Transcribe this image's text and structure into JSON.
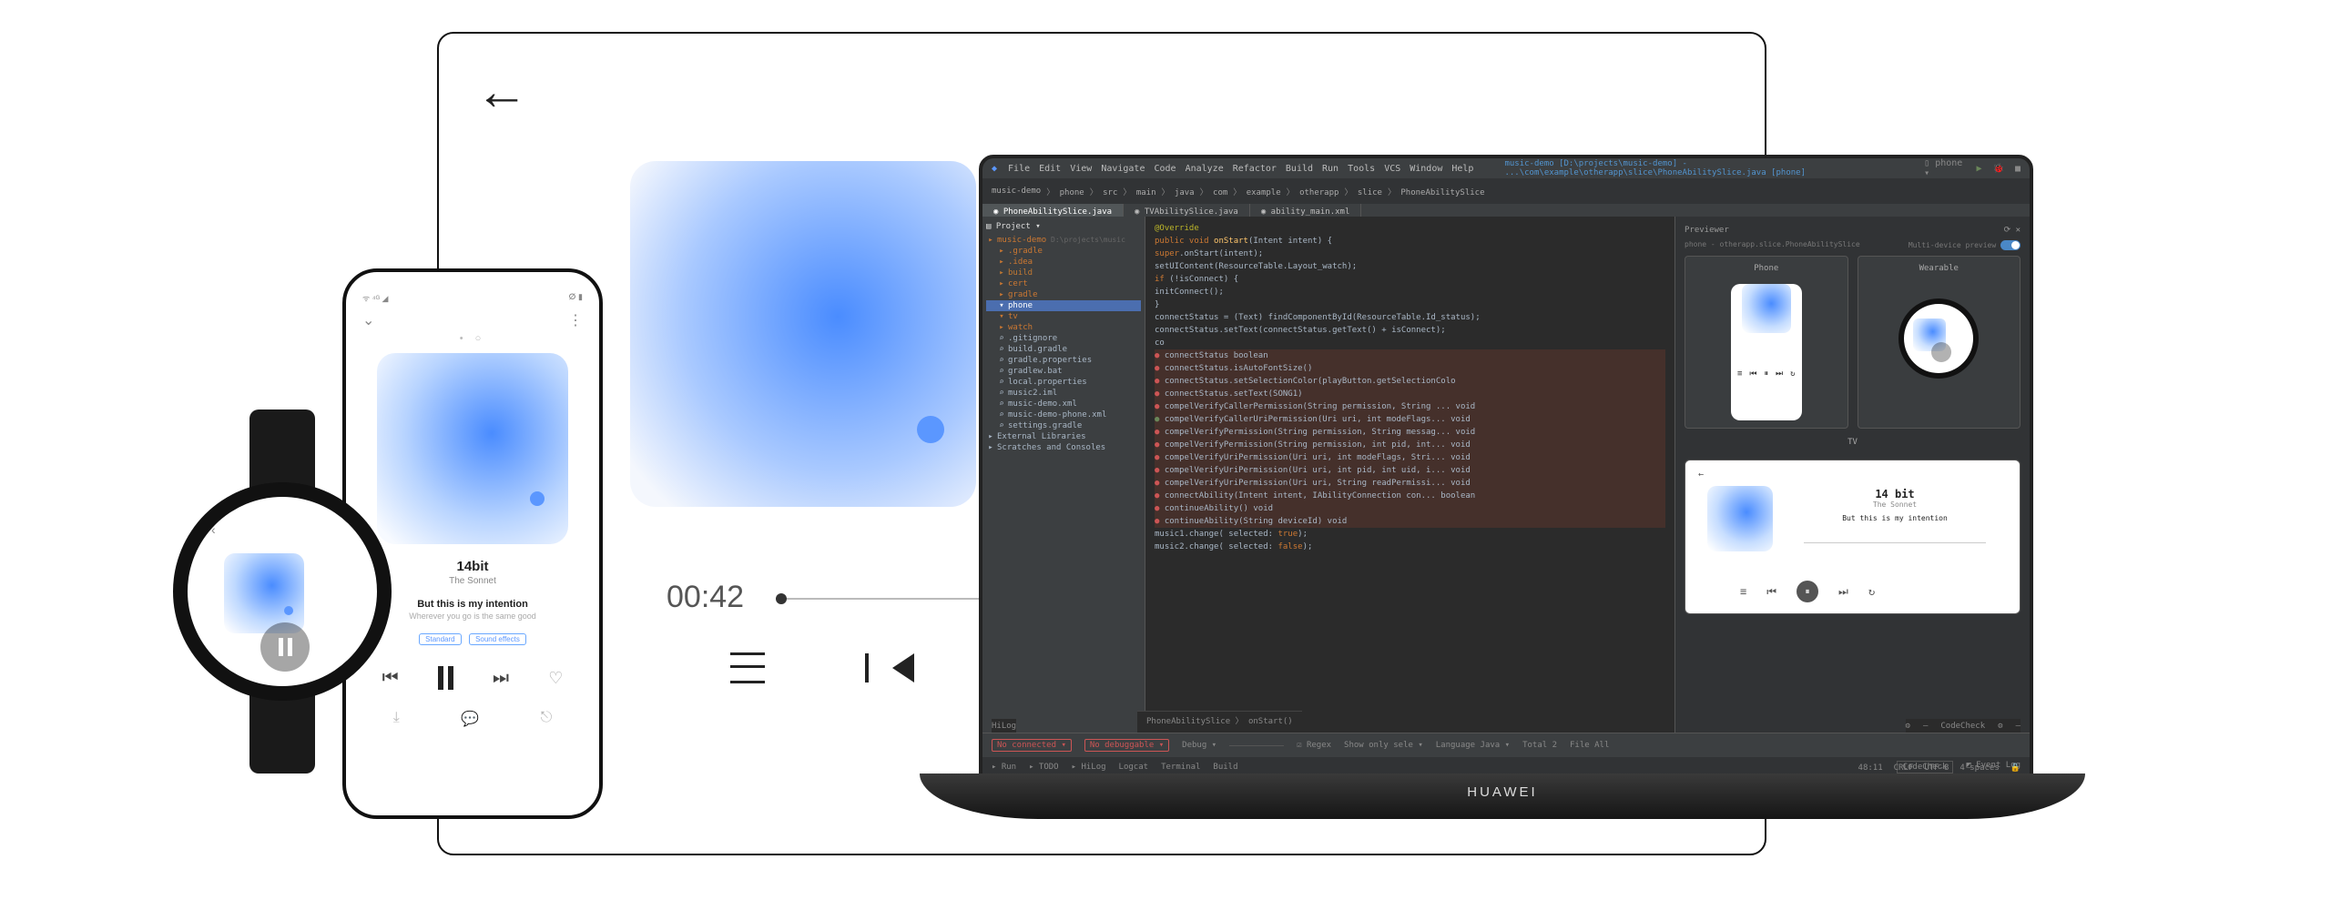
{
  "tv": {
    "time": "00:42"
  },
  "phone": {
    "status_left": "ᯤ ⁴ᴳ ◢",
    "status_right": "ⵁ ▮",
    "title": "14bit",
    "artist": "The Sonnet",
    "lyric1": "But this is my intention",
    "lyric2": "Wherever you go is the same good",
    "badge1": "Standard",
    "badge2": "Sound effects"
  },
  "laptop_brand": "HUAWEI",
  "ide": {
    "menu": [
      "File",
      "Edit",
      "View",
      "Navigate",
      "Code",
      "Analyze",
      "Refactor",
      "Build",
      "Run",
      "Tools",
      "VCS",
      "Window",
      "Help"
    ],
    "project_title": "music-demo [D:\\projects\\music-demo] - ...\\com\\example\\otherapp\\slice\\PhoneAbilitySlice.java [phone]",
    "crumb": [
      "music-demo",
      "phone",
      "src",
      "main",
      "java",
      "com",
      "example",
      "otherapp",
      "slice",
      "PhoneAbilitySlice"
    ],
    "run_target": "phone",
    "tabs": [
      {
        "label": "PhoneAbilitySlice.java",
        "active": true
      },
      {
        "label": "TVAbilitySlice.java",
        "active": false
      },
      {
        "label": "ability_main.xml",
        "active": false
      }
    ],
    "tree_header": "Project",
    "tree": [
      {
        "indent": 0,
        "icon": "▸",
        "label": "music-demo",
        "cls": "folder",
        "suffix": " D:\\projects\\music"
      },
      {
        "indent": 1,
        "icon": "▸",
        "label": ".gradle",
        "cls": "folder"
      },
      {
        "indent": 1,
        "icon": "▸",
        "label": ".idea",
        "cls": "folder"
      },
      {
        "indent": 1,
        "icon": "▸",
        "label": "build",
        "cls": "folder",
        "style": "color:#c07832"
      },
      {
        "indent": 1,
        "icon": "▸",
        "label": "cert",
        "cls": "folder"
      },
      {
        "indent": 1,
        "icon": "▸",
        "label": "gradle",
        "cls": "folder"
      },
      {
        "indent": 1,
        "icon": "▾",
        "label": "phone",
        "cls": "folder selected"
      },
      {
        "indent": 1,
        "icon": "▾",
        "label": "tv",
        "cls": "folder"
      },
      {
        "indent": 1,
        "icon": "▸",
        "label": "watch",
        "cls": "folder"
      },
      {
        "indent": 1,
        "icon": "⌕",
        "label": ".gitignore",
        "cls": "file"
      },
      {
        "indent": 1,
        "icon": "⌕",
        "label": "build.gradle",
        "cls": "file"
      },
      {
        "indent": 1,
        "icon": "⌕",
        "label": "gradle.properties",
        "cls": "file"
      },
      {
        "indent": 1,
        "icon": "⌕",
        "label": "gradlew.bat",
        "cls": "file"
      },
      {
        "indent": 1,
        "icon": "⌕",
        "label": "local.properties",
        "cls": "file"
      },
      {
        "indent": 1,
        "icon": "⌕",
        "label": "music2.iml",
        "cls": "file"
      },
      {
        "indent": 1,
        "icon": "⌕",
        "label": "music-demo.xml",
        "cls": "file"
      },
      {
        "indent": 1,
        "icon": "⌕",
        "label": "music-demo-phone.xml",
        "cls": "file"
      },
      {
        "indent": 1,
        "icon": "⌕",
        "label": "settings.gradle",
        "cls": "file"
      },
      {
        "indent": 0,
        "icon": "▸",
        "label": "External Libraries",
        "cls": "file"
      },
      {
        "indent": 0,
        "icon": "▸",
        "label": "Scratches and Consoles",
        "cls": "file"
      }
    ],
    "code": [
      {
        "t": "ann",
        "text": "@Override"
      },
      {
        "t": "",
        "text": "<kw>public void</kw> <fn>onStart</fn>(Intent intent) {"
      },
      {
        "t": "",
        "text": "    <kw>super</kw>.onStart(intent);"
      },
      {
        "t": "",
        "text": "    setUIContent(ResourceTable.<ty>Layout_watch</ty>);"
      },
      {
        "t": "",
        "text": "    <kw>if</kw> (!isConnect) {"
      },
      {
        "t": "",
        "text": "        initConnect();"
      },
      {
        "t": "",
        "text": "    }"
      },
      {
        "t": "",
        "text": "    connectStatus = (Text) findComponentById(ResourceTable.<ty>Id_status</ty>);"
      },
      {
        "t": "",
        "text": "    connectStatus.setText(connectStatus.getText() + isConnect);"
      },
      {
        "t": "",
        "text": "    co"
      },
      {
        "t": "er dotred",
        "text": "connectStatus                                          boolean"
      },
      {
        "t": "er dotred",
        "text": "connectStatus.isAutoFontSize()"
      },
      {
        "t": "er dotred",
        "text": "connectStatus.setSelectionColor(playButton.getSelectionColo"
      },
      {
        "t": "er dotred",
        "text": "connectStatus.setText(SONG1)"
      },
      {
        "t": "er dotred",
        "text": "compelVerifyCallerPermission(String permission, String ...  void"
      },
      {
        "t": "er dotgrn",
        "text": "compelVerifyCallerUriPermission(Uri uri, int modeFlags...   void"
      },
      {
        "t": "er dotred",
        "text": "compelVerifyPermission(String permission, String messag...  void"
      },
      {
        "t": "er dotred",
        "text": "compelVerifyPermission(String permission, int pid, int...   void"
      },
      {
        "t": "er dotred",
        "text": "compelVerifyUriPermission(Uri uri, int modeFlags, Stri...   void"
      },
      {
        "t": "er dotred",
        "text": "compelVerifyUriPermission(Uri uri, int pid, int uid, i...   void"
      },
      {
        "t": "er dotred",
        "text": "compelVerifyUriPermission(Uri uri, String readPermissi...   void"
      },
      {
        "t": "er dotred",
        "text": "connectAbility(Intent intent, IAbilityConnection con...  boolean"
      },
      {
        "t": "er dotred",
        "text": "continueAbility()                                           void"
      },
      {
        "t": "er dotred",
        "text": "continueAbility(String deviceId)                            void"
      },
      {
        "t": "",
        "text": "    <ty>music1</ty>.change( selected: <kw>true</kw>);"
      },
      {
        "t": "",
        "text": "    <ty>music2</ty>.change( selected: <kw>false</kw>);"
      }
    ],
    "code_footer": "PhoneAbilitySlice 〉 onStart()",
    "preview": {
      "header": "Previewer",
      "subheader": "phone - otherapp.slice.PhoneAbilitySlice",
      "multi_label": "Multi-device preview",
      "phone_label": "Phone",
      "wearable_label": "Wearable",
      "tv_label": "TV",
      "tv_card": {
        "title": "14 bit",
        "artist": "The Sonnet",
        "lyric": "But this is my intention"
      }
    },
    "bottom_tool": {
      "label1": "HiLog",
      "settings": "⚙",
      "codecheck": "CodeCheck"
    },
    "bottombar": {
      "no_connected": "No connected",
      "no_debuggable": "No debuggable",
      "debug": "Debug",
      "regex": "Regex",
      "show_only": "Show only sele",
      "language": "Language",
      "lang_val": "Java",
      "total": "Total",
      "total_val": "2",
      "file": "File",
      "file_val": "All"
    },
    "status_tabs": [
      "Run",
      "TODO",
      "HiLog",
      "Logcat",
      "Terminal",
      "Build"
    ],
    "status_right": {
      "codecheck": "CodeCheck",
      "eventlog": "Event Log"
    },
    "footer": {
      "pos": "48:11",
      "crlf": "CRLF",
      "enc": "UTF-8",
      "indent": "4 spaces"
    }
  }
}
